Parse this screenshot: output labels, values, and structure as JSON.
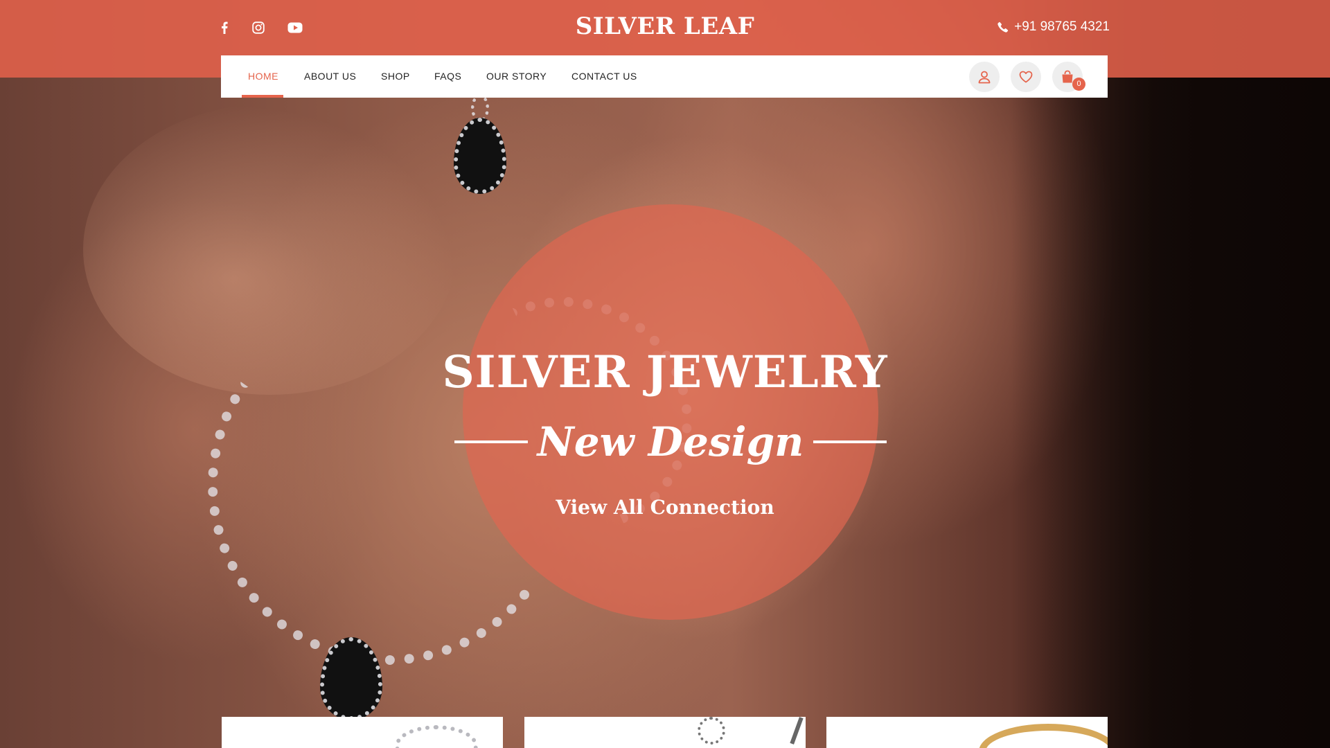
{
  "brand": {
    "name": "SILVER LEAF"
  },
  "social": [
    {
      "name": "facebook-icon"
    },
    {
      "name": "instagram-icon"
    },
    {
      "name": "youtube-icon"
    }
  ],
  "contact": {
    "phone": "+91 98765 4321"
  },
  "nav": {
    "items": [
      {
        "label": "HOME",
        "active": true
      },
      {
        "label": "ABOUT US",
        "active": false
      },
      {
        "label": "SHOP",
        "active": false
      },
      {
        "label": "FAQS",
        "active": false
      },
      {
        "label": "OUR STORY",
        "active": false
      },
      {
        "label": "CONTACT US",
        "active": false
      }
    ],
    "cart_count": "0"
  },
  "hero": {
    "title": "SILVER JEWELRY",
    "subtitle": "New Design",
    "cta": "View All Connection"
  },
  "colors": {
    "accent": "#e5644c",
    "header_band": "#e2614b",
    "nav_bg": "#ffffff",
    "icon_button_bg": "#eeeeee"
  }
}
